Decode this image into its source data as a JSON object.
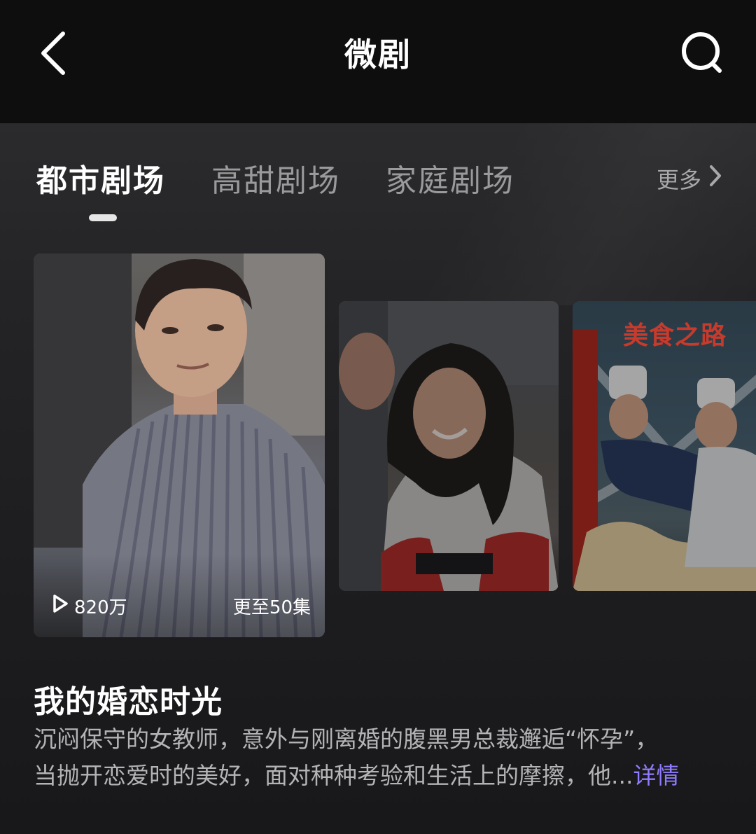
{
  "header": {
    "title": "微剧",
    "back_icon": "chevron-left-icon",
    "search_icon": "search-icon"
  },
  "tabs": [
    {
      "label": "都市剧场",
      "active": true
    },
    {
      "label": "高甜剧场",
      "active": false
    },
    {
      "label": "家庭剧场",
      "active": false
    }
  ],
  "more": {
    "label": "更多",
    "icon": "chevron-right-icon"
  },
  "featured": {
    "plays": "820万",
    "episodes": "更至50集",
    "play_icon": "play-icon",
    "title": "我的婚恋时光",
    "description_line1": "沉闷保守的女教师，意外与刚离婚的腹黑男总裁邂逅“怀孕”，",
    "description_line2": "当抛开恋爱时的美好，面对种种考验和生活上的摩擦，他...",
    "details_label": "详情"
  },
  "posters": [
    {
      "title": ""
    },
    {
      "title": "美食之路"
    }
  ],
  "colors": {
    "accent": "#8f7cff",
    "header_bg": "#0e0e0f",
    "page_bg": "#232325"
  }
}
